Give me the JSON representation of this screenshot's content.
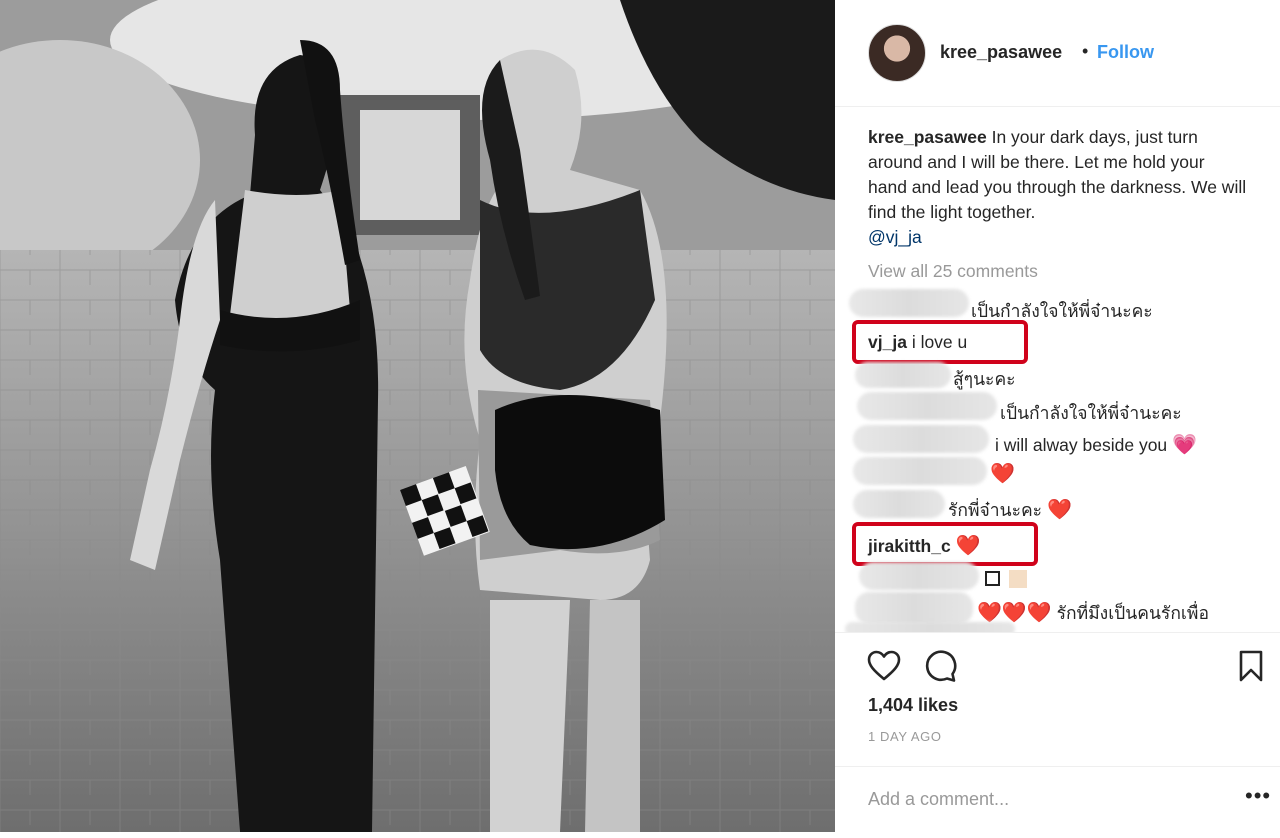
{
  "post": {
    "username": "kree_pasawee",
    "separator": "•",
    "follow_label": "Follow",
    "caption_username": "kree_pasawee",
    "caption_text": "In your dark days, just turn around and I will be there. Let me hold your hand and lead you through the darkness. We will find the light together.",
    "caption_mention": "@vj_ja",
    "view_all_label": "View all 25 comments"
  },
  "comments": [
    {
      "user": "",
      "text": "เป็นกำลังใจให้พี่จ๋านะคะ"
    },
    {
      "user": "vj_ja",
      "text": "i love u"
    },
    {
      "user": "",
      "text": "สู้ๆนะคะ"
    },
    {
      "user": "",
      "text": "เป็นกำลังใจให้พี่จ๋านะคะ"
    },
    {
      "user": "",
      "text": "i will alway beside you",
      "emoji": "💗"
    },
    {
      "user": "",
      "text": "",
      "emoji": "❤️"
    },
    {
      "user": "",
      "text": "รักพี่จ๋านะคะ",
      "emoji": "❤️"
    },
    {
      "user": "jirakitth_c",
      "text": "",
      "emoji": "❤️"
    },
    {
      "user": "",
      "text": ""
    },
    {
      "user": "",
      "text": "รักที่มึงเป็นคนรักเพื่อ",
      "emoji": "❤️❤️❤️"
    }
  ],
  "actions": {
    "like_icon": "heart-outline-icon",
    "comment_icon": "speech-bubble-icon",
    "save_icon": "bookmark-icon",
    "likes": "1,404 likes",
    "timestamp": "1 DAY AGO",
    "add_comment_placeholder": "Add a comment...",
    "more_label": "•••"
  },
  "colors": {
    "accent": "#3897f0",
    "highlight": "#d0021b",
    "muted": "#999999",
    "text": "#262626"
  }
}
